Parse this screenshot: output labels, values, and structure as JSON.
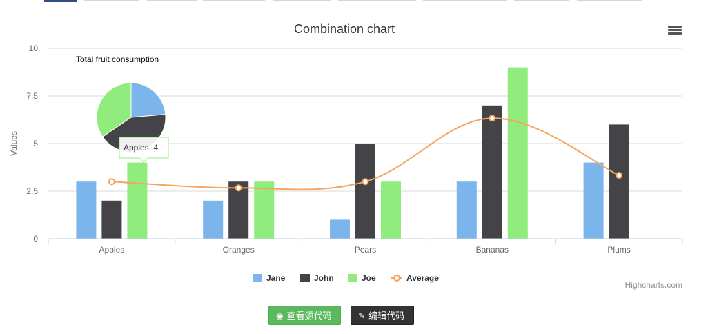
{
  "chart_data": {
    "type": "combination",
    "title": "Combination chart",
    "ylabel": "Values",
    "ylim": [
      0,
      10
    ],
    "yticks": [
      "0",
      "2.5",
      "5",
      "7.5",
      "10"
    ],
    "ytick_values": [
      0,
      2.5,
      5,
      7.5,
      10
    ],
    "categories": [
      "Apples",
      "Oranges",
      "Pears",
      "Bananas",
      "Plums"
    ],
    "series": [
      {
        "name": "Jane",
        "type": "column",
        "color": "#7cb5ec",
        "values": [
          3,
          2,
          1,
          3,
          4
        ]
      },
      {
        "name": "John",
        "type": "column",
        "color": "#434348",
        "values": [
          2,
          3,
          5,
          7,
          6
        ]
      },
      {
        "name": "Joe",
        "type": "column",
        "color": "#90ed7d",
        "values": [
          4,
          3,
          3,
          9,
          0
        ]
      },
      {
        "name": "Average",
        "type": "spline",
        "color": "#f7a35c",
        "values": [
          3,
          2.67,
          3,
          6.33,
          3.33
        ]
      }
    ],
    "pie": {
      "title": "Total fruit consumption",
      "slices": [
        {
          "name": "Jane",
          "value": 13,
          "color": "#7cb5ec"
        },
        {
          "name": "John",
          "value": 23,
          "color": "#434348"
        },
        {
          "name": "Joe",
          "value": 19,
          "color": "#90ed7d"
        }
      ]
    },
    "tooltip": "Apples: 4",
    "grid": true,
    "legend": "bottom-center"
  },
  "credits": "Highcharts.com",
  "buttons": {
    "view_source": "查看源代码",
    "edit_code": "编辑代码"
  }
}
